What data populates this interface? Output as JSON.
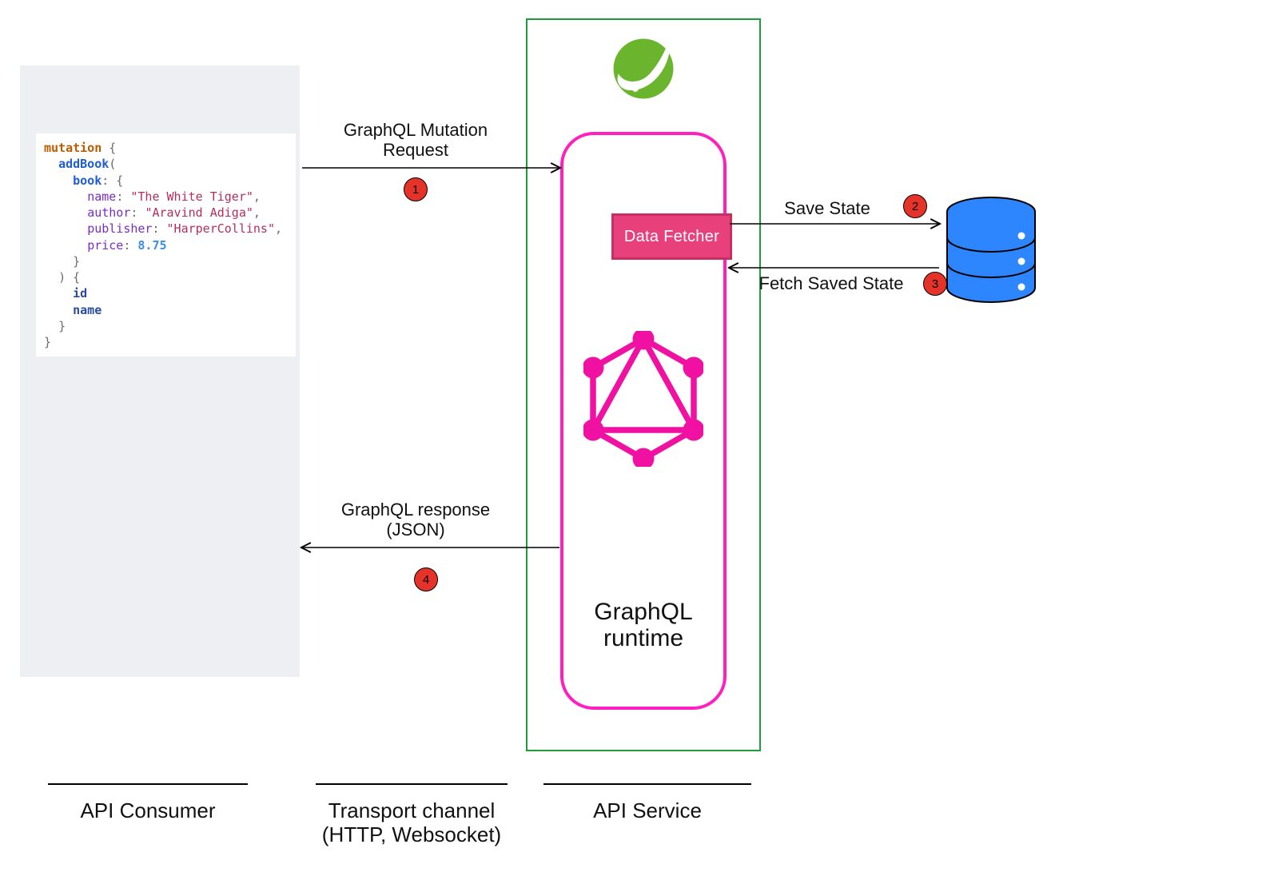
{
  "code": {
    "mutation_kw": "mutation",
    "addBook": "addBook",
    "book": "book",
    "name_prop": "name",
    "name_val": "\"The White Tiger\"",
    "author_prop": "author",
    "author_val": "\"Aravind Adiga\"",
    "publisher_prop": "publisher",
    "publisher_val": "\"HarperCollins\"",
    "price_prop": "price",
    "price_val": "8.75",
    "ret_id": "id",
    "ret_name": "name"
  },
  "labels": {
    "request": "GraphQL Mutation\nRequest",
    "response": "GraphQL response\n(JSON)",
    "save": "Save State",
    "fetch": "Fetch Saved State",
    "data_fetcher": "Data Fetcher",
    "runtime": "GraphQL\nruntime"
  },
  "badges": {
    "b1": "1",
    "b2": "2",
    "b3": "3",
    "b4": "4"
  },
  "footer": {
    "consumer": "API Consumer",
    "transport_line1": "Transport channel",
    "transport_line2": "(HTTP, Websocket)",
    "service": "API Service"
  }
}
